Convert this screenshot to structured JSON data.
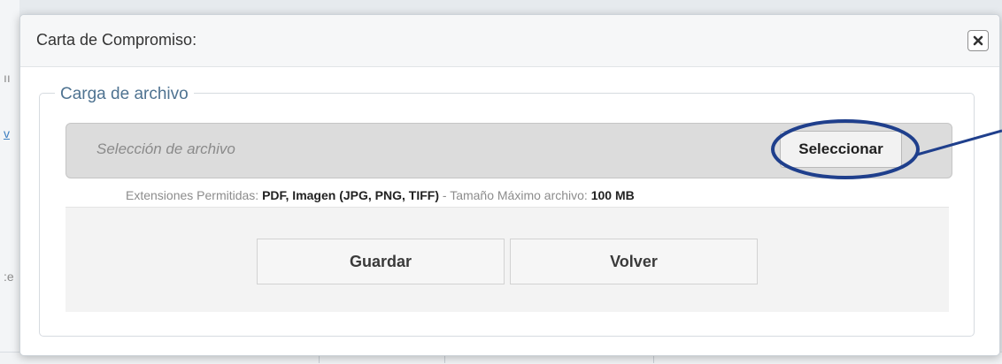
{
  "modal": {
    "title": "Carta de Compromiso:",
    "close_icon": "close-icon"
  },
  "upload": {
    "legend": "Carga de archivo",
    "placeholder": "Selección de archivo",
    "select_label": "Seleccionar",
    "ext_prefix": "Extensiones Permitidas: ",
    "ext_values": "PDF, Imagen (JPG, PNG, TIFF)",
    "size_prefix": " - Tamaño Máximo archivo: ",
    "size_value": "100 MB"
  },
  "actions": {
    "save_label": "Guardar",
    "back_label": "Volver"
  },
  "annotation": {
    "color": "#1f3f8c"
  }
}
